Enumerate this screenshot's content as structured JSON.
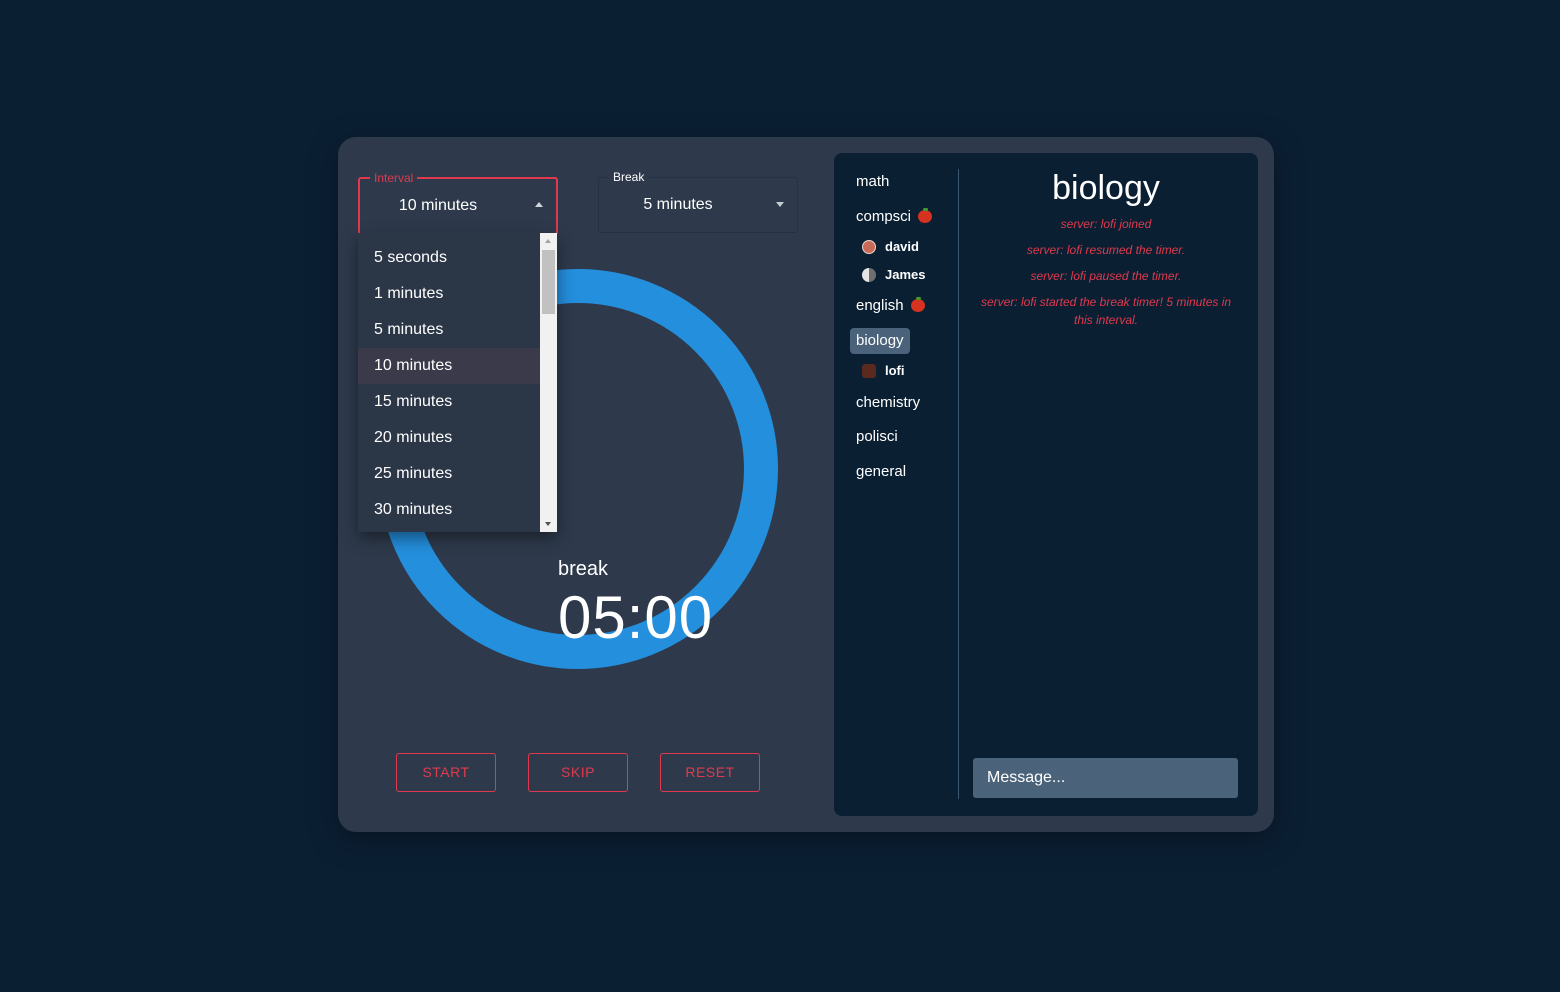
{
  "timer": {
    "interval_label": "Interval",
    "interval_value": "10 minutes",
    "break_label": "Break",
    "break_value": "5 minutes",
    "phase": "break",
    "time": "05:00",
    "progress": 1.0,
    "ring_color": "#248fdd"
  },
  "interval_options": [
    "5 seconds",
    "1 minutes",
    "5 minutes",
    "10 minutes",
    "15 minutes",
    "20 minutes",
    "25 minutes",
    "30 minutes"
  ],
  "selected_option": "10 minutes",
  "buttons": {
    "start": "START",
    "skip": "SKIP",
    "reset": "RESET"
  },
  "rooms": [
    {
      "name": "math",
      "tomato": false,
      "active": false,
      "users": []
    },
    {
      "name": "compsci",
      "tomato": true,
      "active": false,
      "users": [
        "david",
        "James"
      ]
    },
    {
      "name": "english",
      "tomato": true,
      "active": false,
      "users": []
    },
    {
      "name": "biology",
      "tomato": false,
      "active": true,
      "users": [
        "lofi"
      ]
    },
    {
      "name": "chemistry",
      "tomato": false,
      "active": false,
      "users": []
    },
    {
      "name": "polisci",
      "tomato": false,
      "active": false,
      "users": []
    },
    {
      "name": "general",
      "tomato": false,
      "active": false,
      "users": []
    }
  ],
  "chat": {
    "title": "biology",
    "messages": [
      "server: lofi joined",
      "server: lofi resumed the timer.",
      "server: lofi paused the timer.",
      "server: lofi started the break timer! 5 minutes in this interval."
    ],
    "input_placeholder": "Message..."
  },
  "colors": {
    "accent": "#e0394d",
    "background": "#0b1f33",
    "card": "#2e3a4c"
  }
}
